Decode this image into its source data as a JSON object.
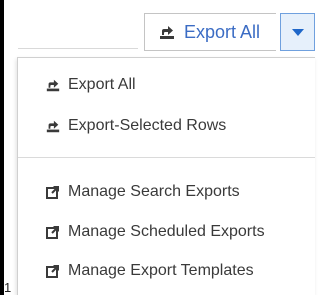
{
  "toolbar": {
    "export_all_label": "Export All",
    "export_all_icon": "export-icon",
    "toggle_icon": "caret-down-icon"
  },
  "menu": {
    "items": [
      {
        "label": "Export All",
        "icon": "export-icon"
      },
      {
        "label": "Export-Selected Rows",
        "icon": "export-icon"
      },
      {
        "label": "Manage Search Exports",
        "icon": "external-link-icon"
      },
      {
        "label": "Manage Scheduled Exports",
        "icon": "external-link-icon"
      },
      {
        "label": "Manage Export Templates",
        "icon": "external-link-icon"
      }
    ]
  },
  "background": {
    "corner_text": "1"
  },
  "colors": {
    "accent": "#3b6cc4",
    "toggle_bg": "#e6f0fb",
    "toggle_border": "#6fa0de",
    "menu_text": "#3a3a3a"
  }
}
